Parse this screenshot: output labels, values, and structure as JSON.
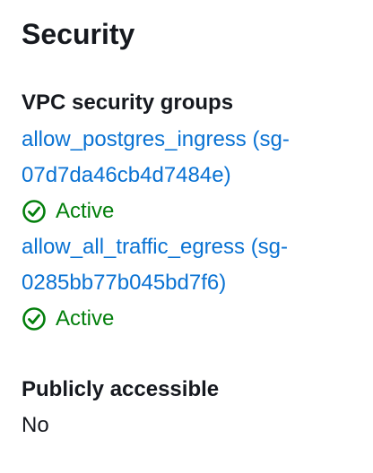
{
  "section": {
    "title": "Security"
  },
  "vpc_security_groups": {
    "label": "VPC security groups",
    "groups": [
      {
        "link_line1": "allow_postgres_ingress (sg-",
        "link_line2": "07d7da46cb4d7484e)",
        "status": "Active",
        "status_icon": "check-circle-icon"
      },
      {
        "link_line1": "allow_all_traffic_egress (sg-",
        "link_line2": "0285bb77b045bd7f6)",
        "status": "Active",
        "status_icon": "check-circle-icon"
      }
    ]
  },
  "public_access": {
    "label": "Publicly accessible",
    "value": "No"
  },
  "colors": {
    "link": "#0972d3",
    "success": "#037f0c",
    "text": "#16191f"
  }
}
